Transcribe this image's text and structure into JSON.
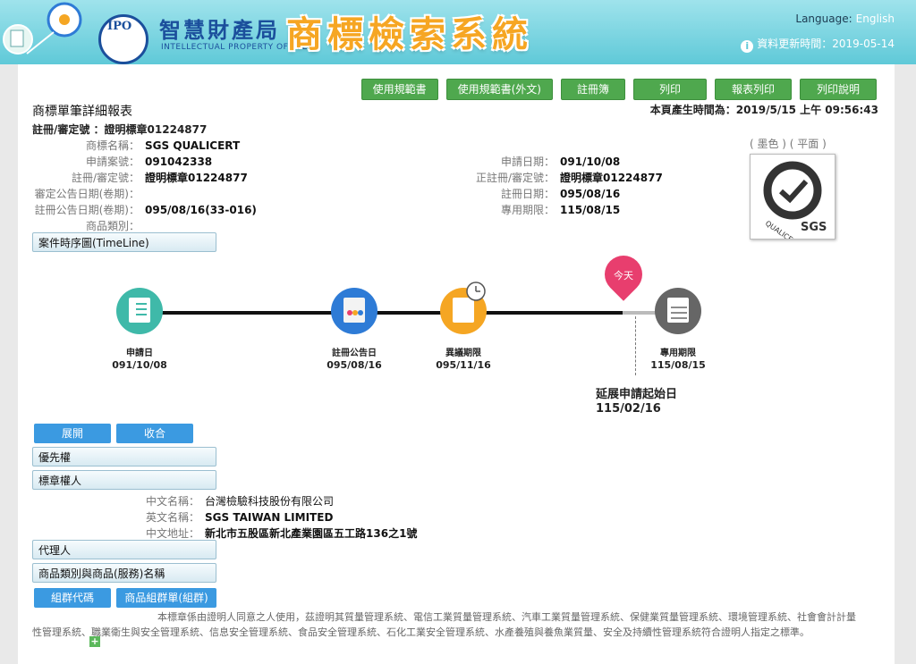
{
  "header": {
    "org_logo_text": "IPO",
    "org_name_cn": "智慧財產局",
    "org_name_en": "INTELLECTUAL PROPERTY OFFICE",
    "system_title": "商標檢索系統",
    "language_label": "Language:",
    "language_value": "English",
    "update_label": "資料更新時間：2019-05-14"
  },
  "toolbar": [
    "使用規範書",
    "使用規範書(外文)",
    "註冊簿",
    "列印",
    "報表列印",
    "列印說明"
  ],
  "report": {
    "title": "商標單筆詳細報表",
    "generated": "本頁產生時間為：2019/5/15 上午 09:56:43",
    "reg_no_line": "註冊/審定號 ：證明標章01224877"
  },
  "details_left": [
    {
      "label": "商標名稱：",
      "value": "SGS QUALICERT"
    },
    {
      "label": "申請案號：",
      "value": "091042338"
    },
    {
      "label": "註冊/審定號：",
      "value": "證明標章01224877"
    },
    {
      "label": "審定公告日期(卷期)：",
      "value": ""
    },
    {
      "label": "註冊公告日期(卷期)：",
      "value": "095/08/16(33-016)"
    },
    {
      "label": "商品類別：",
      "value": ""
    }
  ],
  "details_right": [
    {
      "label": "申請日期：",
      "value": "091/10/08"
    },
    {
      "label": "正註冊/審定號：",
      "value": "證明標章01224877"
    },
    {
      "label": "註冊日期：",
      "value": "095/08/16"
    },
    {
      "label": "專用期限：",
      "value": "115/08/15"
    }
  ],
  "image_caption": "( 墨色 ) ( 平面 )",
  "mark_text": "QUALICERT SGS",
  "timeline": {
    "section": "案件時序圖(TimeLine)",
    "nodes": [
      {
        "label": "申請日",
        "date": "091/10/08",
        "color": "#3fb9a9"
      },
      {
        "label": "註冊公告日",
        "date": "095/08/16",
        "color": "#2e7bd6"
      },
      {
        "label": "異議期限",
        "date": "095/11/16",
        "color": "#f5a623"
      },
      {
        "label": "專用期限",
        "date": "115/08/15",
        "color": "#666666"
      }
    ],
    "today": "今天",
    "extension_label": "延展申請起始日",
    "extension_date": "115/02/16"
  },
  "buttons": {
    "expand": "展開",
    "collapse": "收合",
    "group_code": "組群代碼",
    "group_list": "商品組群單(組群)"
  },
  "sections": {
    "priority": "優先權",
    "owner": "標章權人",
    "agent": "代理人",
    "goods": "商品類別與商品(服務)名稱"
  },
  "owner": [
    {
      "label": "中文名稱：",
      "value": "台灣檢驗科技股份有限公司"
    },
    {
      "label": "英文名稱：",
      "value": "SGS TAIWAN LIMITED"
    },
    {
      "label": "中文地址：",
      "value": "新北市五股區新北產業園區五工路136之1號"
    }
  ],
  "goods_description": "本標章係由證明人同意之人使用，茲證明其質量管理系統、電信工業質量管理系統、汽車工業質量管理系統、保健業質量管理系統、環境管理系統、社會會計計量性管理系統、職業衛生與安全管理系統、信息安全管理系統、食品安全管理系統、石化工業安全管理系統、水產養殖與養魚業質量、安全及持續性管理系統符合證明人指定之標準。",
  "colors": {
    "header": "#5fc9d8",
    "toolbar_green": "#4fa84e",
    "button_blue": "#3b9ae1",
    "today_pin": "#e83e6e"
  }
}
